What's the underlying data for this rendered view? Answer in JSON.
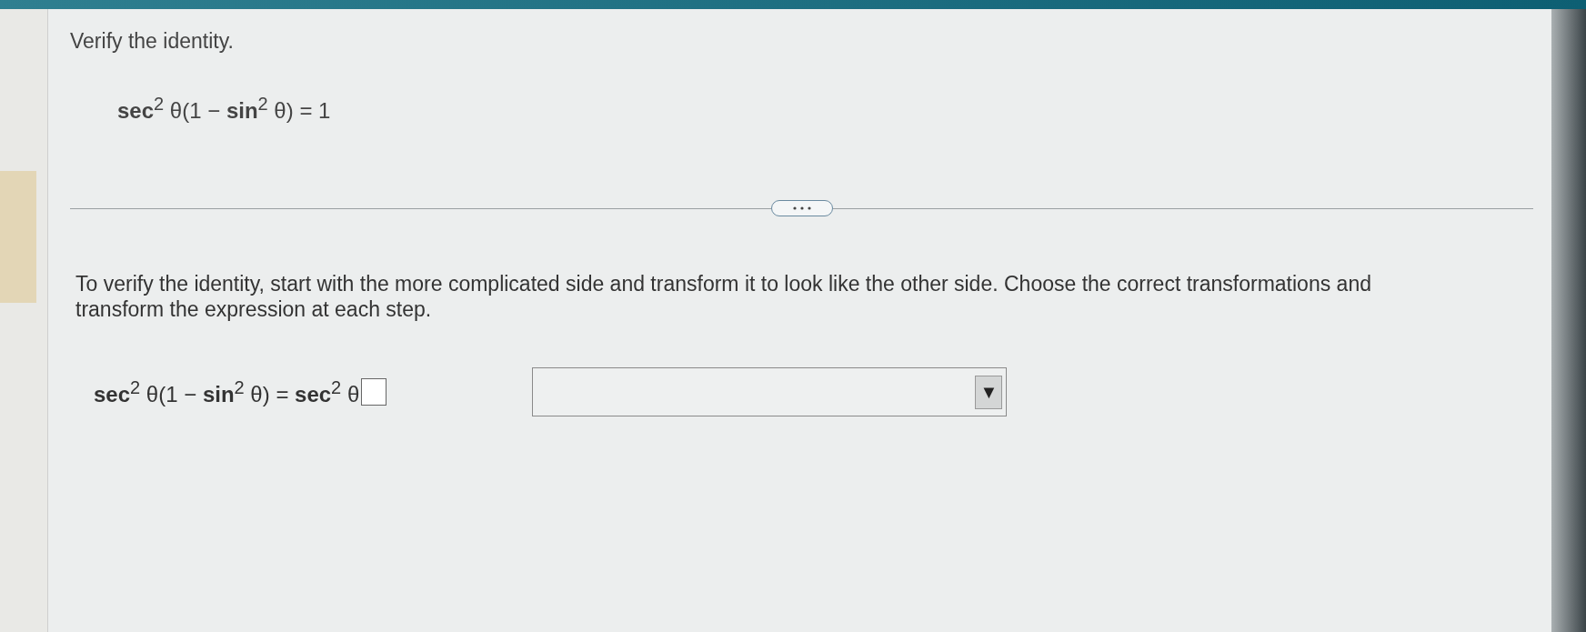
{
  "question": {
    "title": "Verify the identity.",
    "identity": "**sec**$^{2}$ θ(1 − **sin**$^{2}$ θ) = 1"
  },
  "instructions": "To verify the identity, start with the more complicated side and transform it to look like the other side. Choose the correct transformations and transform the expression at each step.",
  "step": {
    "expression": "**sec**$^{2}$ θ(1 − **sin**$^{2}$ θ) = **sec**$^{2}$ θ",
    "dropdown": {
      "arrow": "▼"
    }
  }
}
